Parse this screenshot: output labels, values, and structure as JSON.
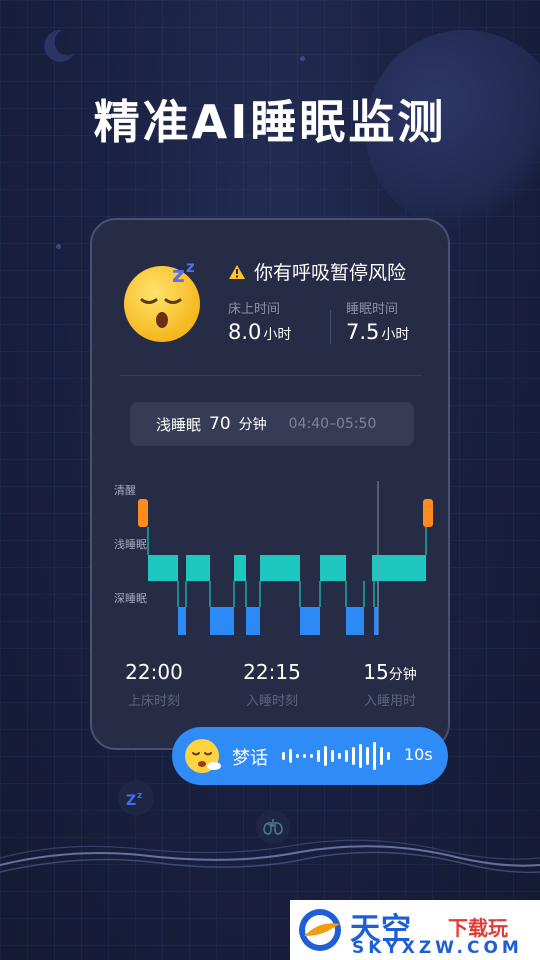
{
  "headline": "精准AI睡眠监测",
  "card": {
    "warning": "你有呼吸暂停风险",
    "bed_time": {
      "label": "床上时间",
      "value": "8.0",
      "unit": "小时"
    },
    "sleep_time": {
      "label": "睡眠时间",
      "value": "7.5",
      "unit": "小时"
    },
    "selected_stage": {
      "name": "浅睡眠",
      "value": "70",
      "unit": "分钟",
      "range": "04:40–05:50"
    },
    "chart_axis": [
      "清醒",
      "浅睡眠",
      "深睡眠"
    ],
    "footer": [
      {
        "value": "22:00",
        "unit": "",
        "label": "上床时刻"
      },
      {
        "value": "22:15",
        "unit": "",
        "label": "入睡时刻"
      },
      {
        "value": "15",
        "unit": "分钟",
        "label": "入睡用时"
      }
    ]
  },
  "colors": {
    "awake": "#ff8a1e",
    "light": "#1ec8c0",
    "deep": "#2b8af5",
    "card_bg": "#262c45",
    "bubble": "#2f8bf5"
  },
  "bubble": {
    "label": "梦话",
    "duration": "10s"
  },
  "icons": [
    "moon-icon",
    "sleeping-emoji-icon",
    "warning-icon",
    "zzz-icon",
    "lungs-icon",
    "dream-talk-emoji-icon"
  ],
  "watermark": {
    "cn_main": "天空",
    "cn_sub": "下载玩",
    "en": "SKYXZW.COM"
  }
}
